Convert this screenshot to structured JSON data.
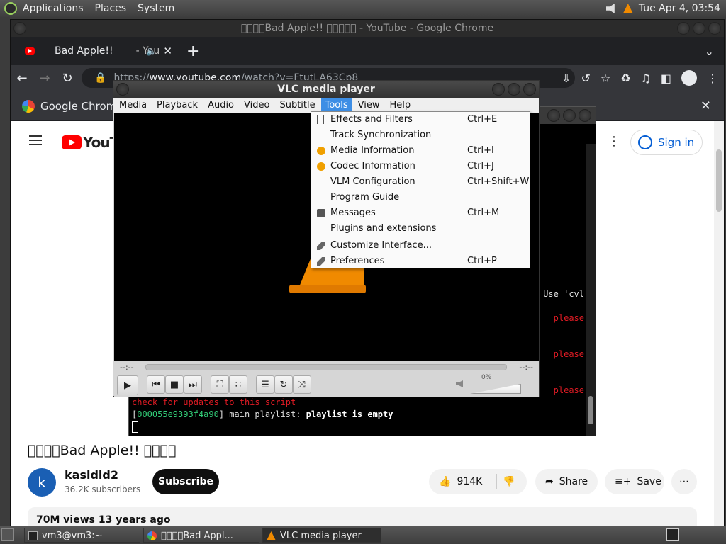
{
  "top_panel": {
    "menus": [
      "Applications",
      "Places",
      "System"
    ],
    "clock": "Tue Apr  4, 03:54"
  },
  "chrome": {
    "window_title": "􀀀􀀀􀀀􀀀Bad Apple!! 􀀀􀀀􀀀􀀀􀀀 - YouTube - Google Chrome",
    "tab_title": "Bad Apple!!",
    "tab_title_suffix": "- You",
    "url_scheme": "https://",
    "url_host": "www.youtube.com",
    "url_path": "/watch?v=FtutLA63Cp8",
    "infobar_text": "Google Chrom"
  },
  "youtube": {
    "logo_text": "YouTu",
    "sign_in": "Sign in",
    "video_title": "􀀀􀀀􀀀􀀀Bad Apple!!  􀀀􀀀􀀀􀀀",
    "channel_initial": "k",
    "channel_name": "kasidid2",
    "subscribers": "36.2K subscribers",
    "subscribe": "Subscribe",
    "likes": "914K",
    "share": "Share",
    "save": "Save",
    "views_line": "70M views  13 years ago"
  },
  "terminal": {
    "right_snippet": "Use 'cvl",
    "please": "please",
    "update_line": "check for updates to this script",
    "playlist_prefix": "[",
    "playlist_addr": "000055e9393f4a90",
    "playlist_mid": "] main playlist: ",
    "playlist_msg": "playlist is empty"
  },
  "vlc": {
    "title": "VLC media player",
    "menu": [
      "Media",
      "Playback",
      "Audio",
      "Video",
      "Subtitle",
      "Tools",
      "View",
      "Help"
    ],
    "time_elapsed": "--:--",
    "time_total": "--:--",
    "volume_pct": "0%",
    "tools_menu": [
      {
        "label": "Effects and Filters",
        "shortcut": "Ctrl+E",
        "icon": "equalizer-icon"
      },
      {
        "label": "Track Synchronization",
        "shortcut": "",
        "icon": ""
      },
      {
        "label": "Media Information",
        "shortcut": "Ctrl+I",
        "icon": "info-icon"
      },
      {
        "label": "Codec Information",
        "shortcut": "Ctrl+J",
        "icon": "info-icon"
      },
      {
        "label": "VLM Configuration",
        "shortcut": "Ctrl+Shift+W",
        "icon": ""
      },
      {
        "label": "Program Guide",
        "shortcut": "",
        "icon": ""
      },
      {
        "label": "Messages",
        "shortcut": "Ctrl+M",
        "icon": "terminal-icon"
      },
      {
        "label": "Plugins and extensions",
        "shortcut": "",
        "icon": ""
      },
      {
        "label": "Customize Interface...",
        "shortcut": "",
        "icon": "wrench-icon"
      },
      {
        "label": "Preferences",
        "shortcut": "Ctrl+P",
        "icon": "wrench-icon"
      }
    ]
  },
  "taskbar": {
    "items": [
      "vm3@vm3:~",
      "􀀀􀀀􀀀􀀀Bad Appl...",
      "VLC media player"
    ]
  },
  "colors": {
    "vlc_orange": "#f08a00",
    "menu_highlight": "#3d8ee5",
    "youtube_red": "#ff0000",
    "terminal_red": "#e01b24",
    "terminal_green": "#33d17a"
  }
}
